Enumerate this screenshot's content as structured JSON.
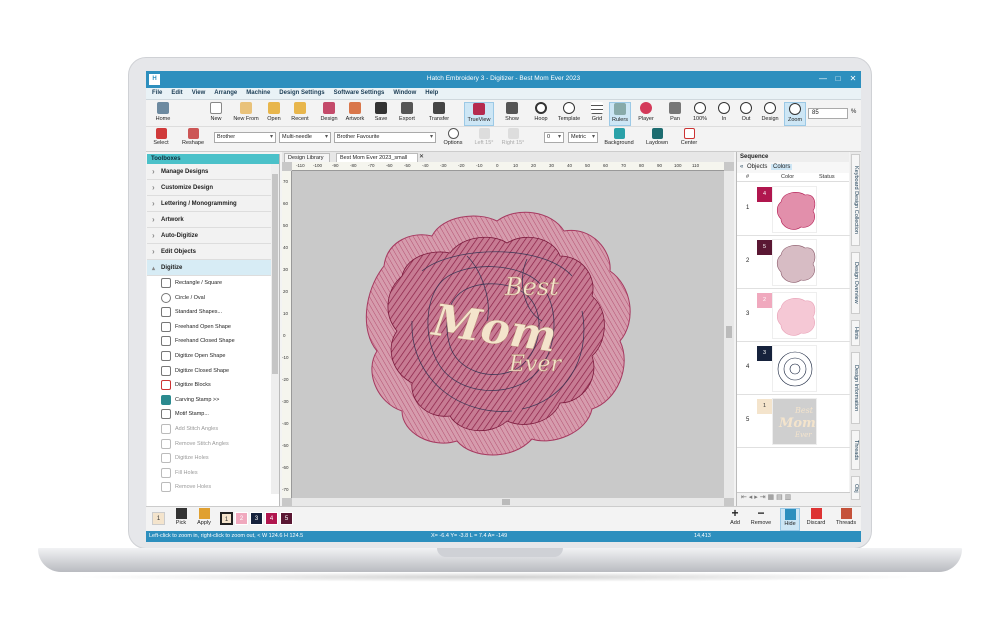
{
  "window": {
    "title": "Hatch Embroidery 3 - Digitizer - Best Mom Ever 2023",
    "app_icon": "H",
    "controls": [
      "—",
      "□",
      "✕"
    ]
  },
  "menu": [
    "File",
    "Edit",
    "View",
    "Arrange",
    "Machine",
    "Design Settings",
    "Software Settings",
    "Window",
    "Help"
  ],
  "toolbar": {
    "home": "Home",
    "new": "New",
    "new_from": "New From",
    "open": "Open",
    "recent": "Recent",
    "design": "Design",
    "artwork": "Artwork",
    "save": "Save",
    "export": "Export",
    "transfer": "Transfer",
    "trueview": "TrueView",
    "show": "Show",
    "hoop": "Hoop",
    "template": "Template",
    "grid": "Grid",
    "rulers": "Rulers",
    "player": "Player",
    "pan": "Pan",
    "zoom100": "100%",
    "in": "In",
    "out": "Out",
    "zoom_design": "Design",
    "zoom": "Zoom",
    "zoom_value": "85",
    "zoom_unit": "%"
  },
  "toolbar2": {
    "select": "Select",
    "reshape": "Reshape",
    "machine_brand": "Brother",
    "machine_type": "Multi-needle",
    "thread_chart": "Brother Favourite",
    "options": "Options",
    "left": "Left 15°",
    "right": "Right 15°",
    "angle": "0",
    "units": "Metric",
    "background": "Background",
    "laydown": "Laydown",
    "center": "Center"
  },
  "toolboxes": {
    "header": "Toolboxes",
    "categories": [
      "Manage Designs",
      "Customize Design",
      "Lettering / Monogramming",
      "Artwork",
      "Auto-Digitize",
      "Edit Objects",
      "Digitize"
    ],
    "digitize_items": [
      {
        "label": "Rectangle / Square",
        "disabled": false
      },
      {
        "label": "Circle / Oval",
        "disabled": false
      },
      {
        "label": "Standard Shapes...",
        "disabled": false
      },
      {
        "label": "Freehand Open Shape",
        "disabled": false
      },
      {
        "label": "Freehand Closed Shape",
        "disabled": false
      },
      {
        "label": "Digitize Open Shape",
        "disabled": false
      },
      {
        "label": "Digitize Closed Shape",
        "disabled": false
      },
      {
        "label": "Digitize Blocks",
        "disabled": false
      },
      {
        "label": "Carving Stamp >>",
        "disabled": false
      },
      {
        "label": "Motif Stamp...",
        "disabled": false
      },
      {
        "label": "Add Stitch Angles",
        "disabled": true
      },
      {
        "label": "Remove Stitch Angles",
        "disabled": true
      },
      {
        "label": "Digitize Holes",
        "disabled": true
      },
      {
        "label": "Fill Holes",
        "disabled": true
      },
      {
        "label": "Remove Holes",
        "disabled": true
      }
    ]
  },
  "doc_tabs": {
    "library": "Design Library",
    "active": "Best Mom Ever 2023_small",
    "close": "✕"
  },
  "ruler_h_ticks": [
    "-110",
    "-100",
    "-90",
    "-80",
    "-70",
    "-60",
    "-50",
    "-40",
    "-30",
    "-20",
    "-10",
    "0",
    "10",
    "20",
    "30",
    "40",
    "50",
    "60",
    "70",
    "80",
    "90",
    "100",
    "110"
  ],
  "ruler_v_ticks": [
    "70",
    "60",
    "50",
    "40",
    "30",
    "20",
    "10",
    "0",
    "-10",
    "-20",
    "-30",
    "-40",
    "-50",
    "-60",
    "-70"
  ],
  "design": {
    "line1": "Best",
    "line2": "Mom",
    "line3": "Ever"
  },
  "sequence": {
    "title": "Sequence",
    "tabs": [
      "Objects",
      "Colors"
    ],
    "active_tab": "Colors",
    "headers": {
      "num": "#",
      "color": "Color",
      "status": "Status"
    },
    "rows": [
      {
        "num": "1",
        "swatch": "4",
        "color": "#b0164e"
      },
      {
        "num": "2",
        "swatch": "5",
        "color": "#5a1733"
      },
      {
        "num": "3",
        "swatch": "2",
        "color": "#f0a9be"
      },
      {
        "num": "4",
        "swatch": "3",
        "color": "#16223c"
      },
      {
        "num": "5",
        "swatch": "1",
        "color": "#f4e4cc"
      }
    ]
  },
  "side_tabs": [
    "Keyboard Design Collection",
    "Design Overview",
    "Hints",
    "Design Information",
    "Threads",
    "Obj"
  ],
  "bottom": {
    "current_color": "1",
    "pick": "Pick",
    "apply": "Apply",
    "palette": [
      {
        "label": "1",
        "color": "#f4e4cc"
      },
      {
        "label": "2",
        "color": "#f0a9be"
      },
      {
        "label": "3",
        "color": "#16223c"
      },
      {
        "label": "4",
        "color": "#b0164e"
      },
      {
        "label": "5",
        "color": "#5a1733"
      }
    ],
    "add": "Add",
    "remove": "Remove",
    "hide": "Hide",
    "discard": "Discard",
    "threads": "Threads"
  },
  "status": {
    "hint": "Left-click to zoom in, right-click to zoom out, <    W 124.6 H 124.5",
    "coords": "X=  -6.4 Y=  -3.8 L =   7.4 A= -149",
    "stitches": "14,413"
  },
  "colors": {
    "title_blue": "#2d8fbe",
    "teal": "#4bc1c9",
    "canvas": "#c9c9c9"
  }
}
